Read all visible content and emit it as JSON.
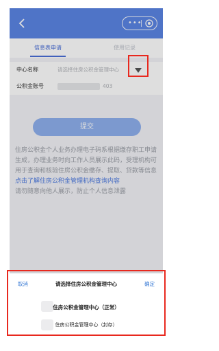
{
  "header": {
    "back_icon": "chevron-left-icon",
    "menu_icon": "more-dots-icon",
    "close_icon": "target-circle-icon",
    "color": "#5b86e5"
  },
  "tabs": [
    {
      "label": "信息表申请",
      "active": true
    },
    {
      "label": "使用记录",
      "active": false
    }
  ],
  "form": {
    "center_label": "中心名称",
    "center_placeholder": "请选择住房公积金管理中心",
    "account_label": "公积金账号",
    "account_suffix": "403"
  },
  "submit_label": "提交",
  "info": {
    "text": "住房公积金个人业务办理电子码系根据缴存职工申请生成，办理业务时向工作人员展示此码，受理机构可用于查询和核验住房公积金缴存、提取、贷款等信息",
    "link": "点击了解住房公积金管理机构查询内容",
    "warning": "请勿随意向他人展示，防止个人信息泄露"
  },
  "picker": {
    "cancel": "取消",
    "title": "请选择住房公积金管理中心",
    "confirm": "确定",
    "options": [
      "住房公积金管理中心（正常）",
      "住房公积金管理中心（封存）"
    ]
  },
  "colors": {
    "accent": "#4a6fd8",
    "highlight": "#e8281e",
    "button": "#8fb0ee"
  }
}
